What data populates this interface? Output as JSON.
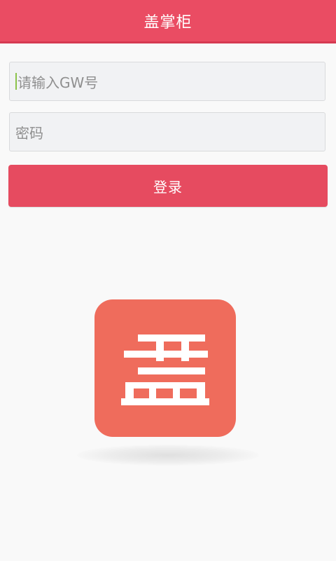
{
  "app": {
    "title": "盖掌柜"
  },
  "login_form": {
    "gw_placeholder": "请输入GW号",
    "password_placeholder": "密码",
    "submit_label": "登录"
  },
  "logo": {
    "glyph": "盖"
  },
  "colors": {
    "brand": "#ea4c63",
    "logo_background": "#ef6c5c",
    "input_background": "#f1f2f4"
  }
}
